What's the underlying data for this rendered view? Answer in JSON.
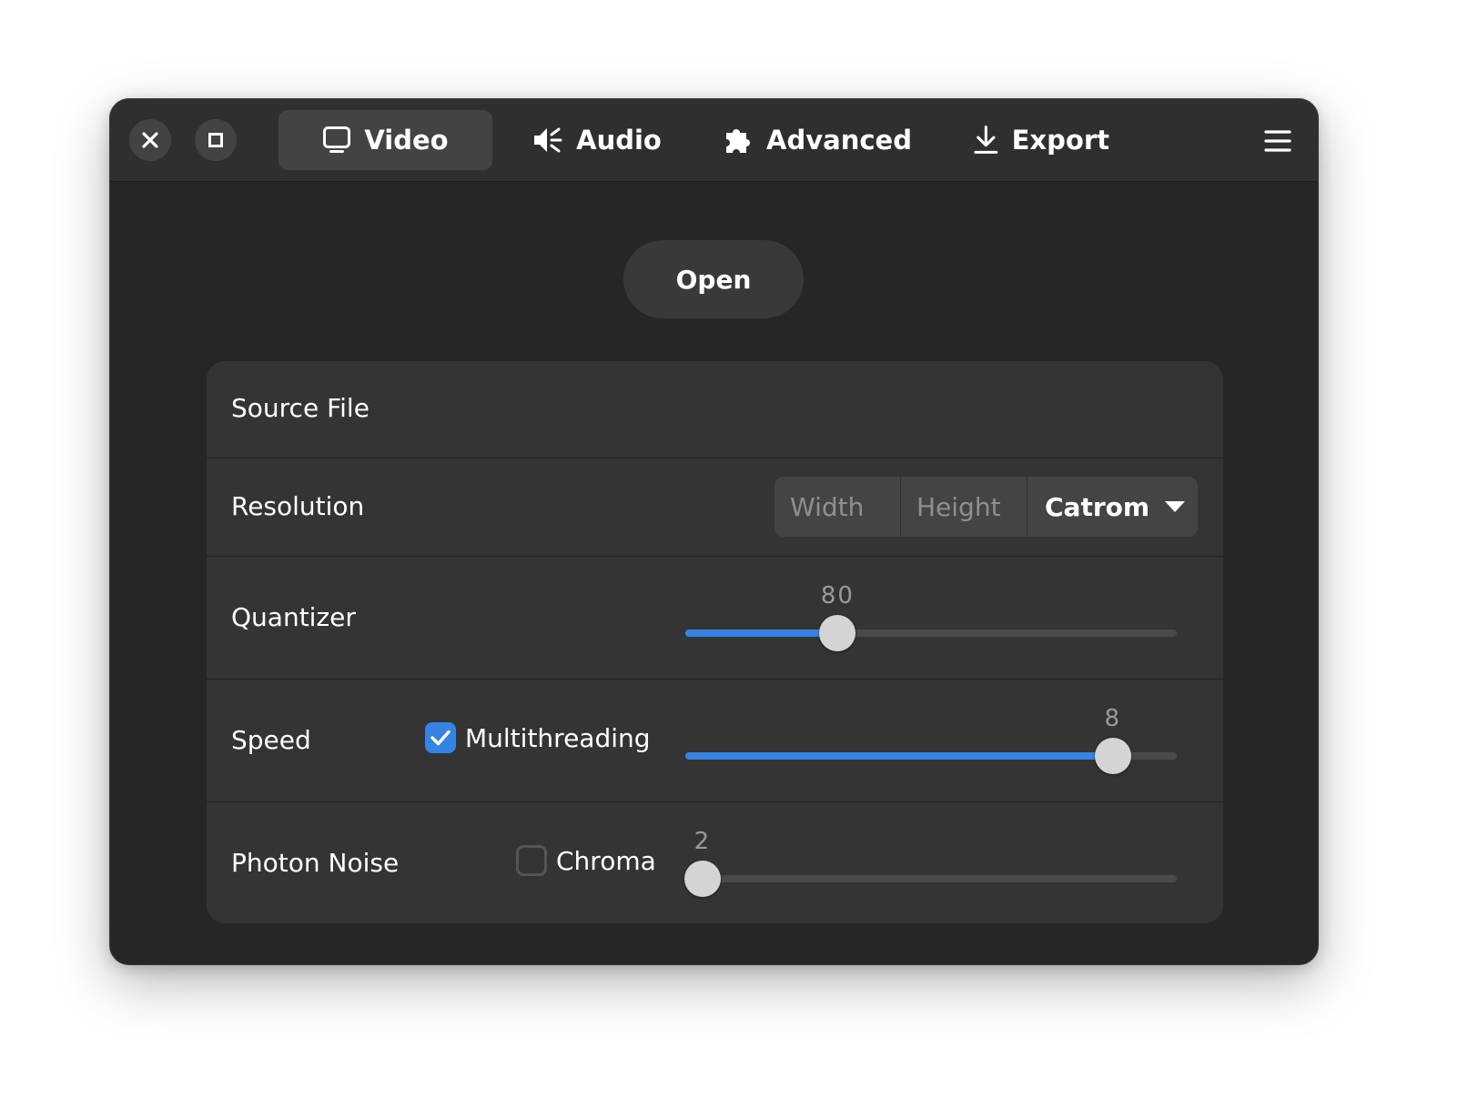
{
  "header": {
    "tabs": [
      {
        "label": "Video",
        "icon": "monitor-icon",
        "active": true
      },
      {
        "label": "Audio",
        "icon": "speaker-icon",
        "active": false
      },
      {
        "label": "Advanced",
        "icon": "puzzle-icon",
        "active": false
      },
      {
        "label": "Export",
        "icon": "download-icon",
        "active": false
      }
    ]
  },
  "open_label": "Open",
  "rows": {
    "source": {
      "label": "Source File"
    },
    "resolution": {
      "label": "Resolution",
      "width_placeholder": "Width",
      "height_placeholder": "Height",
      "scaler": "Catrom"
    },
    "quantizer": {
      "label": "Quantizer",
      "value": "80",
      "fraction": 0.31
    },
    "speed": {
      "label": "Speed",
      "checkbox_label": "Multithreading",
      "checked": true,
      "value": "8",
      "fraction": 0.87
    },
    "photon_noise": {
      "label": "Photon Noise",
      "checkbox_label": "Chroma",
      "checked": false,
      "value": "2",
      "fraction": 0.035
    }
  },
  "colors": {
    "accent": "#3584e4",
    "window_bg": "#262626",
    "card_bg": "#343434"
  }
}
